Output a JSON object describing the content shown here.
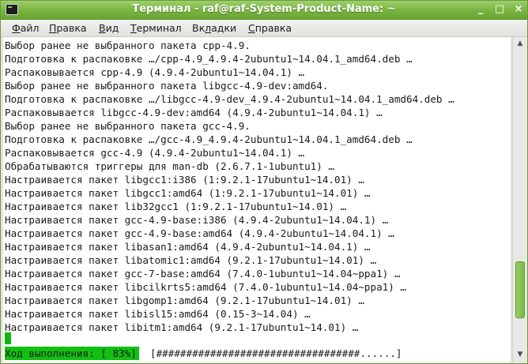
{
  "window": {
    "title": "Терминал - raf@raf-System-Product-Name: ~",
    "minimize_glyph": "_",
    "maximize_glyph": "□",
    "close_glyph": "×",
    "accent_color": "#78b43f"
  },
  "menu": {
    "file": {
      "first": "Ф",
      "rest": "айл"
    },
    "edit": {
      "first": "П",
      "rest": "равка"
    },
    "view": {
      "first": "В",
      "rest": "ид"
    },
    "terminal": {
      "first": "Т",
      "rest": "ерминал"
    },
    "tabs": {
      "first": "",
      "mid": "Вк",
      "under": "л",
      "rest": "адки"
    },
    "help": {
      "first": "С",
      "rest": "правка"
    }
  },
  "terminal": {
    "lines": [
      "Выбор ранее не выбранного пакета cpp-4.9.",
      "Подготовка к распаковке …/cpp-4.9_4.9.4-2ubuntu1~14.04.1_amd64.deb …",
      "Распаковывается cpp-4.9 (4.9.4-2ubuntu1~14.04.1) …",
      "Выбор ранее не выбранного пакета libgcc-4.9-dev:amd64.",
      "Подготовка к распаковке …/libgcc-4.9-dev_4.9.4-2ubuntu1~14.04.1_amd64.deb …",
      "Распаковывается libgcc-4.9-dev:amd64 (4.9.4-2ubuntu1~14.04.1) …",
      "Выбор ранее не выбранного пакета gcc-4.9.",
      "Подготовка к распаковке …/gcc-4.9_4.9.4-2ubuntu1~14.04.1_amd64.deb …",
      "Распаковывается gcc-4.9 (4.9.4-2ubuntu1~14.04.1) …",
      "Обрабатываются триггеры для man-db (2.6.7.1-1ubuntu1) …",
      "Настраивается пакет libgcc1:i386 (1:9.2.1-17ubuntu1~14.01) …",
      "Настраивается пакет libgcc1:amd64 (1:9.2.1-17ubuntu1~14.01) …",
      "Настраивается пакет lib32gcc1 (1:9.2.1-17ubuntu1~14.01) …",
      "Настраивается пакет gcc-4.9-base:i386 (4.9.4-2ubuntu1~14.04.1) …",
      "Настраивается пакет gcc-4.9-base:amd64 (4.9.4-2ubuntu1~14.04.1) …",
      "Настраивается пакет libasan1:amd64 (4.9.4-2ubuntu1~14.04.1) …",
      "Настраивается пакет libatomic1:amd64 (9.2.1-17ubuntu1~14.01) …",
      "Настраивается пакет gcc-7-base:amd64 (7.4.0-1ubuntu1~14.04~ppa1) …",
      "Настраивается пакет libcilkrts5:amd64 (7.4.0-1ubuntu1~14.04~ppa1) …",
      "Настраивается пакет libgomp1:amd64 (9.2.1-17ubuntu1~14.01) …",
      "Настраивается пакет libisl15:amd64 (0.15-3~14.04) …",
      "Настраивается пакет libitm1:amd64 (9.2.1-17ubuntu1~14.01) …"
    ],
    "progress_label": "Ход выполнения: [ 83%]",
    "progress_percent": 83,
    "progress_bar": "[##################################......]",
    "progress_color": "#11c011"
  },
  "scrollbar": {
    "up_glyph": "▲",
    "down_glyph": "▼",
    "thumb_color": "#7cb845"
  }
}
